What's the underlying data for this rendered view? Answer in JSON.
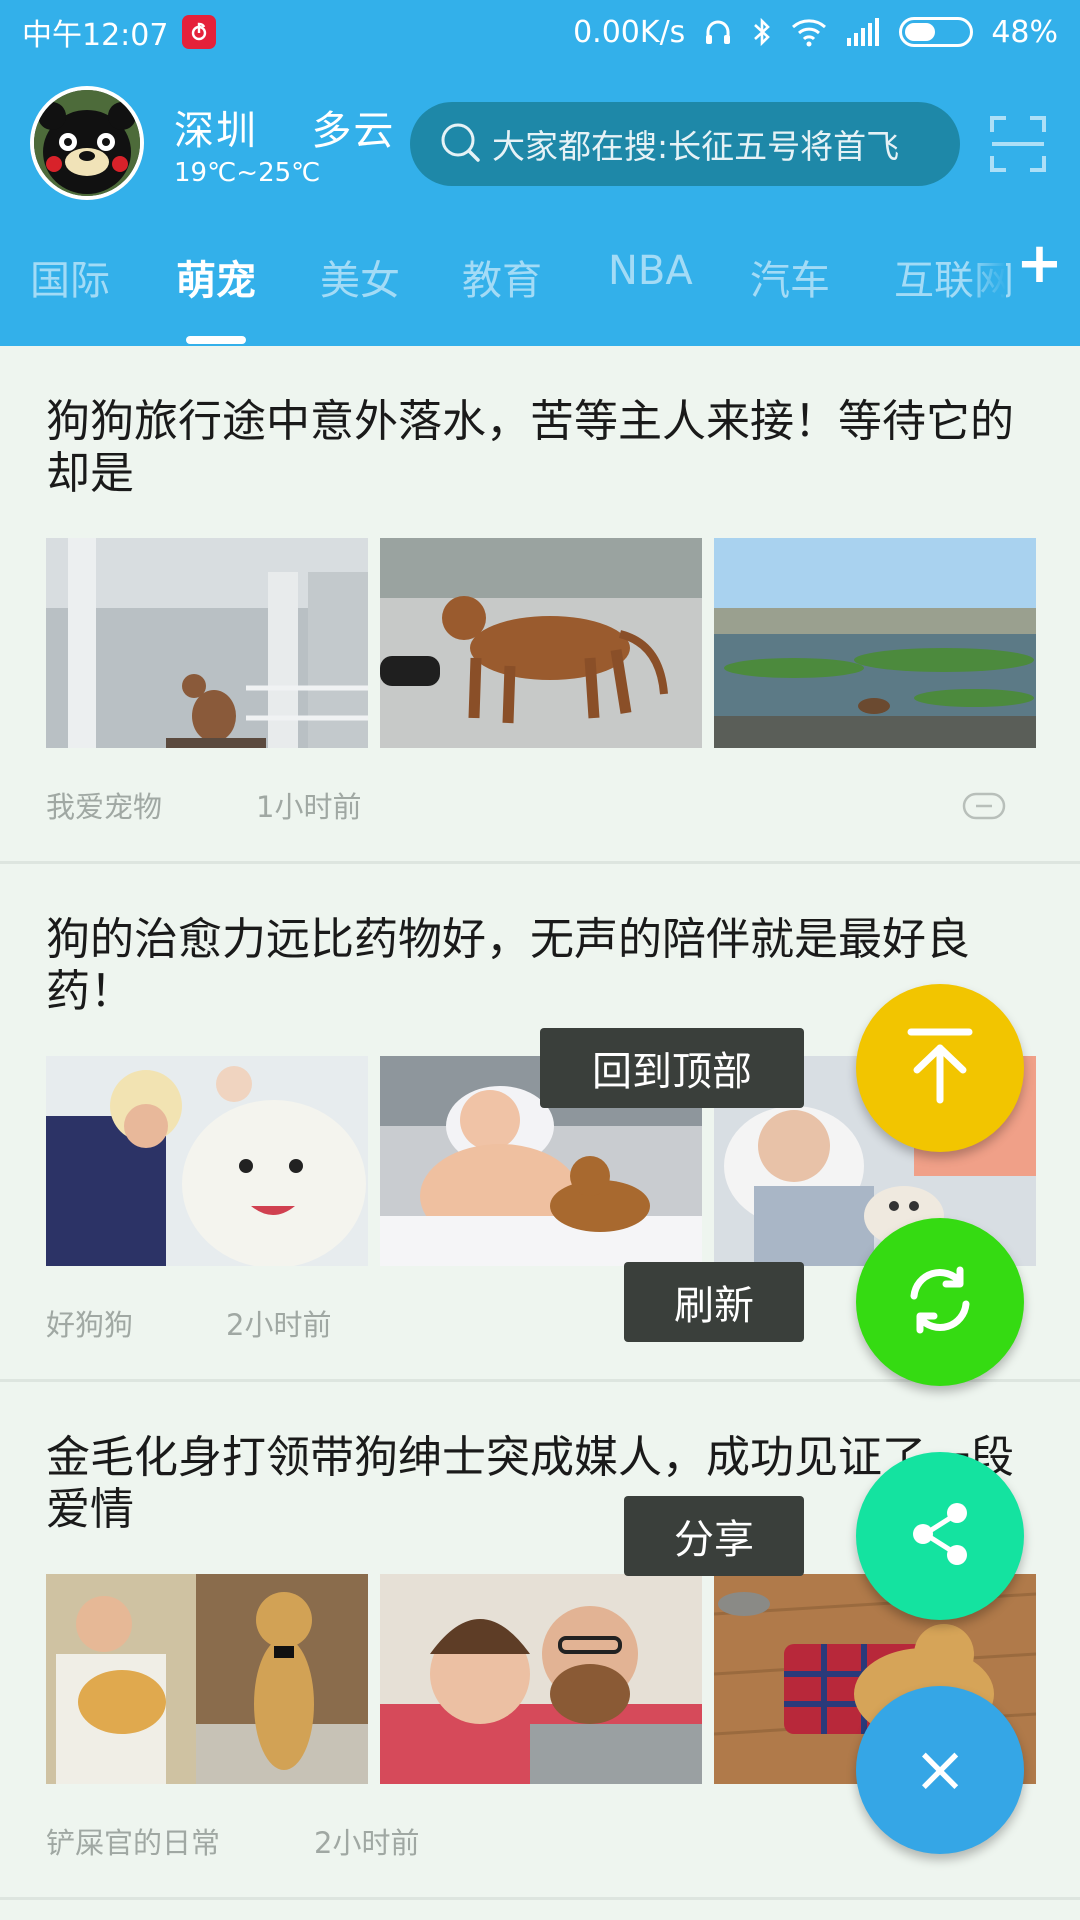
{
  "status_bar": {
    "time": "中午12:07",
    "network_speed": "0.00K/s",
    "battery_percent": "48%",
    "battery_level": 0.48,
    "icons": [
      "netease-music-icon",
      "headphones-icon",
      "bluetooth-icon",
      "wifi-icon",
      "signal-icon",
      "battery-icon"
    ]
  },
  "header": {
    "weather": {
      "city": "深圳",
      "condition": "多云",
      "temp_range": "19℃~25℃"
    },
    "search": {
      "placeholder": "大家都在搜:长征五号将首飞"
    }
  },
  "tabs": {
    "items": [
      "国际",
      "萌宠",
      "美女",
      "教育",
      "NBA",
      "汽车",
      "互联网"
    ],
    "active": "萌宠",
    "add_label": "+"
  },
  "feed": {
    "items": [
      {
        "title": "狗狗旅行途中意外落水，苦等主人来接！等待它的却是",
        "source": "我爱宠物",
        "time": "1小时前"
      },
      {
        "title": "狗的治愈力远比药物好，无声的陪伴就是最好良药！",
        "source": "好狗狗",
        "time": "2小时前"
      },
      {
        "title": "金毛化身打领带狗绅士突成媒人，成功见证了一段爱情",
        "source": "铲屎官的日常",
        "time": "2小时前"
      }
    ]
  },
  "fab_menu": {
    "top_label": "回到顶部",
    "refresh_label": "刷新",
    "share_label": "分享",
    "close_label": "×",
    "colors": {
      "top": "#f2c500",
      "refresh": "#35db12",
      "share": "#14e3a0",
      "close": "#35a6e6"
    }
  },
  "colors": {
    "header": "#33b0ea",
    "search_bg": "#1e88a8",
    "background": "#eef5ef"
  }
}
